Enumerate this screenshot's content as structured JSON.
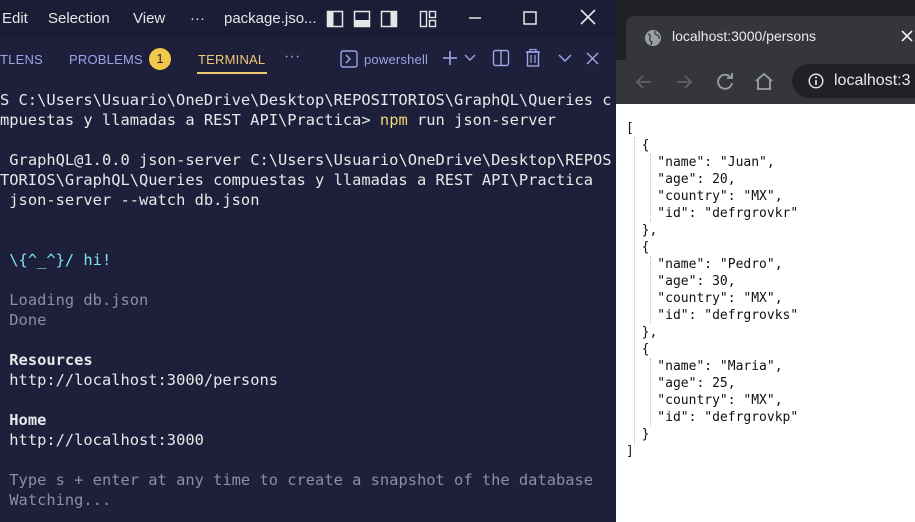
{
  "vscode": {
    "menu": [
      "Edit",
      "Selection",
      "View",
      "···"
    ],
    "file_title": "package.jso...",
    "panel_tabs": [
      {
        "label": "TLENS"
      },
      {
        "label": "PROBLEMS",
        "badge": "1"
      },
      {
        "label": "TERMINAL",
        "active": true
      }
    ],
    "panel_more": "···",
    "shell_name": "powershell",
    "terminal_lines": [
      "S C:\\Users\\Usuario\\OneDrive\\Desktop\\REPOSITORIOS\\GraphQL\\Queries c",
      "mpuestas y llamadas a REST API\\Practica>",
      "npm",
      "run json-server",
      "GraphQL@1.0.0 json-server C:\\Users\\Usuario\\OneDrive\\Desktop\\REPOS",
      "TORIOS\\GraphQL\\Queries compuestas y llamadas a REST API\\Practica",
      "json-server --watch db.json",
      "\\{^_^}/ hi!",
      "Loading db.json",
      "Done",
      "Resources",
      "http://localhost:3000/persons",
      "Home",
      "http://localhost:3000",
      "Type s + enter at any time to create a snapshot of the database",
      "Watching..."
    ],
    "colors": {
      "background": "#1e1f3b",
      "accent": "#f0c674",
      "badge": "#f2c94c",
      "link": "#9ba4e6"
    }
  },
  "browser": {
    "tab_title": "localhost:3000/persons",
    "url": "localhost:3",
    "json_lines": [
      "[",
      "  {",
      "    \"name\": \"Juan\",",
      "    \"age\": 20,",
      "    \"country\": \"MX\",",
      "    \"id\": \"defrgrovkr\"",
      "  },",
      "  {",
      "    \"name\": \"Pedro\",",
      "    \"age\": 30,",
      "    \"country\": \"MX\",",
      "    \"id\": \"defrgrovks\"",
      "  },",
      "  {",
      "    \"name\": \"Maria\",",
      "    \"age\": 25,",
      "    \"country\": \"MX\",",
      "    \"id\": \"defrgrovkp\"",
      "  }",
      "]"
    ],
    "icons": [
      "globe-icon",
      "close-icon",
      "back-icon",
      "forward-icon",
      "reload-icon",
      "home-icon",
      "info-icon"
    ]
  }
}
